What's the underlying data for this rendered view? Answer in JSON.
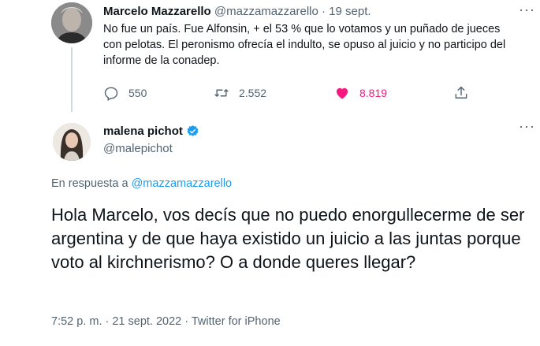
{
  "parent_tweet": {
    "author_name": "Marcelo Mazzarello",
    "author_handle": "@mazzamazzarello",
    "separator": "·",
    "date": "19 sept.",
    "text": "No fue un país. Fue Alfonsin, + el 53 % que lo votamos  y un puñado de jueces con pelotas. El peronismo ofrecía el indulto, se opuso al juicio  y no participo del informe de la conadep.",
    "more_icon": "more-horizontal-icon",
    "actions": {
      "replies": "550",
      "retweets": "2.552",
      "likes": "8.819",
      "reply_icon": "reply-icon",
      "retweet_icon": "retweet-icon",
      "like_icon": "heart-filled-icon",
      "share_icon": "share-icon"
    }
  },
  "main_tweet": {
    "author_name": "malena pichot",
    "author_handle": "@malepichot",
    "verified_icon": "verified-badge-icon",
    "reply_prefix": "En respuesta a",
    "reply_to_handle": "@mazzamazzarello",
    "text": "Hola Marcelo, vos decís que no puedo enorgullecerme de ser argentina y de que haya existido un juicio a las juntas porque voto al kirchnerismo? O a donde queres llegar?",
    "timestamp": "7:52 p. m. · 21 sept. 2022 · Twitter for iPhone",
    "more_icon": "more-horizontal-icon"
  },
  "colors": {
    "text_primary": "#0f1419",
    "text_secondary": "#536471",
    "link": "#1d9bf0",
    "like": "#f91880",
    "thread_line": "#cfd9de"
  }
}
